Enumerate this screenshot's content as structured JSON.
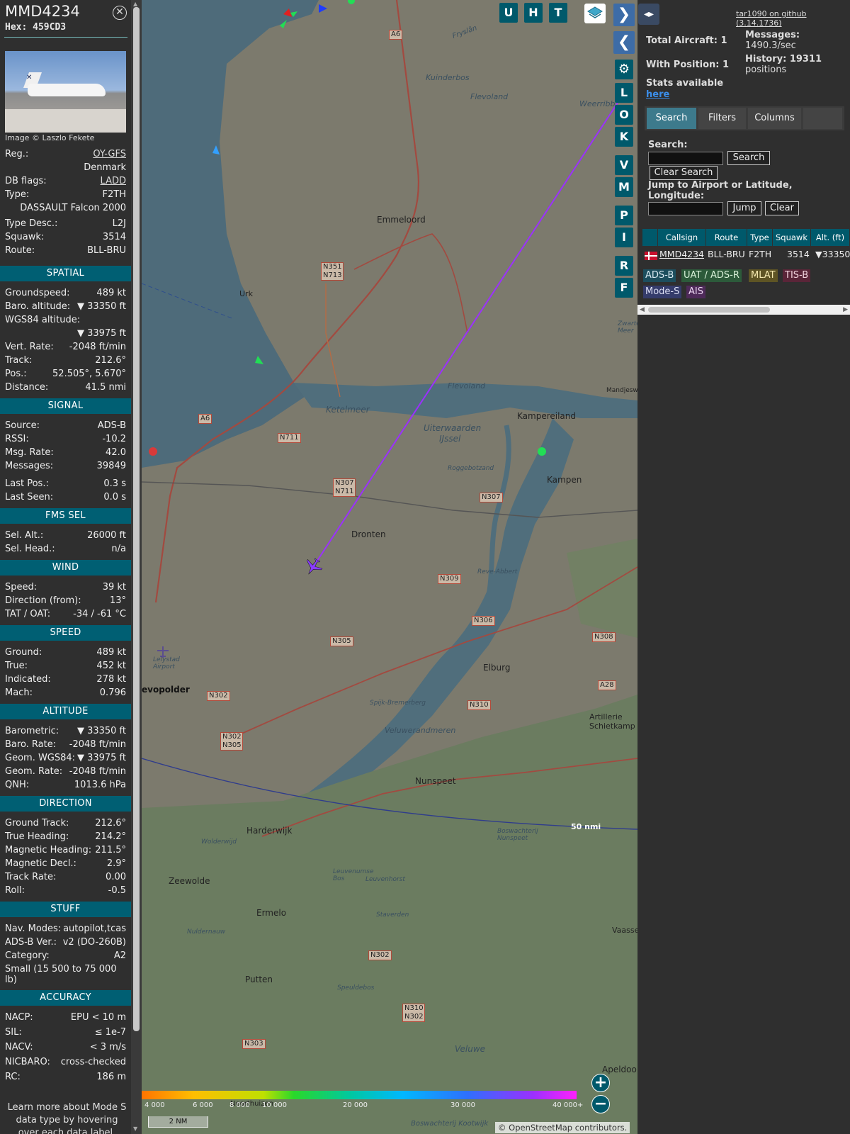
{
  "selected": {
    "callsign": "MMD4234",
    "hex_label": "Hex: 459CD3",
    "image_credit": "Image © Laszlo Fekete",
    "reg_label": "Reg.:",
    "reg": "OY-GFS",
    "country": "Denmark",
    "dbflags_label": "DB flags:",
    "dbflags": "LADD",
    "type_label": "Type:",
    "type": "F2TH",
    "type_full": "DASSAULT Falcon 2000",
    "typedesc_label": "Type Desc.:",
    "typedesc": "L2J",
    "squawk_label": "Squawk:",
    "squawk": "3514",
    "route_label": "Route:",
    "route": "BLL-BRU"
  },
  "sections": {
    "spatial": {
      "title": "SPATIAL",
      "rows": [
        {
          "k": "Groundspeed:",
          "v": "489 kt"
        },
        {
          "k": "Baro. altitude:",
          "v": "▼ 33350 ft"
        },
        {
          "k": "WGS84 altitude:",
          "v": ""
        },
        {
          "k": "",
          "v": "▼ 33975 ft"
        },
        {
          "k": "Vert. Rate:",
          "v": "-2048 ft/min"
        },
        {
          "k": "Track:",
          "v": "212.6°"
        },
        {
          "k": "Pos.:",
          "v": "52.505°, 5.670°"
        },
        {
          "k": "Distance:",
          "v": "41.5 nmi"
        }
      ]
    },
    "signal": {
      "title": "SIGNAL",
      "rows": [
        {
          "k": "Source:",
          "v": "ADS-B"
        },
        {
          "k": "RSSI:",
          "v": "-10.2"
        },
        {
          "k": "Msg. Rate:",
          "v": "42.0"
        },
        {
          "k": "Messages:",
          "v": "39849"
        },
        {
          "k": "Last Pos.:",
          "v": "0.3 s"
        },
        {
          "k": "Last Seen:",
          "v": "0.0 s"
        }
      ]
    },
    "fms": {
      "title": "FMS SEL",
      "rows": [
        {
          "k": "Sel. Alt.:",
          "v": "26000 ft"
        },
        {
          "k": "Sel. Head.:",
          "v": "n/a"
        }
      ]
    },
    "wind": {
      "title": "WIND",
      "rows": [
        {
          "k": "Speed:",
          "v": "39 kt"
        },
        {
          "k": "Direction (from):",
          "v": "13°"
        },
        {
          "k": "TAT / OAT:",
          "v": "-34 / -61 °C"
        }
      ]
    },
    "speed": {
      "title": "SPEED",
      "rows": [
        {
          "k": "Ground:",
          "v": "489 kt"
        },
        {
          "k": "True:",
          "v": "452 kt"
        },
        {
          "k": "Indicated:",
          "v": "278 kt"
        },
        {
          "k": "Mach:",
          "v": "0.796"
        }
      ]
    },
    "altitude": {
      "title": "ALTITUDE",
      "rows": [
        {
          "k": "Barometric:",
          "v": "▼ 33350 ft"
        },
        {
          "k": "Baro. Rate:",
          "v": "-2048 ft/min"
        },
        {
          "k": "Geom. WGS84:",
          "v": "▼ 33975 ft"
        },
        {
          "k": "Geom. Rate:",
          "v": "-2048 ft/min"
        },
        {
          "k": "QNH:",
          "v": "1013.6 hPa"
        }
      ]
    },
    "direction": {
      "title": "DIRECTION",
      "rows": [
        {
          "k": "Ground Track:",
          "v": "212.6°"
        },
        {
          "k": "True Heading:",
          "v": "214.2°"
        },
        {
          "k": "Magnetic Heading:",
          "v": "211.5°"
        },
        {
          "k": "Magnetic Decl.:",
          "v": "2.9°"
        },
        {
          "k": "Track Rate:",
          "v": "0.00"
        },
        {
          "k": "Roll:",
          "v": "-0.5"
        }
      ]
    },
    "stuff": {
      "title": "STUFF",
      "rows": [
        {
          "k": "Nav. Modes:",
          "v": "autopilot,tcas"
        },
        {
          "k": "ADS-B Ver.:",
          "v": "v2 (DO-260B)"
        },
        {
          "k": "Category:",
          "v": "A2"
        }
      ],
      "category_desc": "Small (15 500 to 75 000 lb)"
    },
    "accuracy": {
      "title": "ACCURACY",
      "rows": [
        {
          "k": "NACP:",
          "v": "EPU < 10 m"
        },
        {
          "k": "SIL:",
          "v": "≤ 1e-7"
        },
        {
          "k": "NACV:",
          "v": "< 3 m/s"
        },
        {
          "k": "NICBARO:",
          "v": "cross-checked"
        },
        {
          "k": "RC:",
          "v": "186 m"
        }
      ]
    }
  },
  "learn_more": "Learn more about Mode S data type by hovering over each data label.",
  "map": {
    "buttons_top": [
      "U",
      "H",
      "T"
    ],
    "buttons_side": [
      "L",
      "O",
      "K",
      "V",
      "M",
      "P",
      "I",
      "R",
      "F"
    ],
    "labels": {
      "emmeloord": "Emmeloord",
      "urk": "Urk",
      "dronten": "Dronten",
      "kampen": "Kampen",
      "kampereiland": "Kampereiland",
      "elburg": "Elburg",
      "nunspeet": "Nunspeet",
      "harderwijk": "Harderwijk",
      "zeewolde": "Zeewolde",
      "ermelo": "Ermelo",
      "putten": "Putten",
      "ketelmeer": "Ketelmeer",
      "uiterwaarden": "Uiterwaarden",
      "ijssel": "IJssel",
      "flevoland1": "Flevoland",
      "flevoland2": "Flevoland",
      "veluwerandmeren": "Veluwerandmeren",
      "veluwe": "Veluwe",
      "kuinderbos": "Kuinderbos",
      "lelystad": "Lelystad Airport",
      "evopolder": "evopolder",
      "artillerie": "Artillerie Schietkamp",
      "apeldoo": "Apeldoo",
      "vaasse": "Vaasse",
      "roggebotzand": "Roggebotzand",
      "revebbert": "Reve-Abbert",
      "spijk": "Spijk-Bremerberg",
      "leuvenhorst": "Leuvenhorst",
      "staverden": "Staverden",
      "speuldebos": "Speuldebos",
      "weerribben": "Weerribb",
      "zwarte": "Zwarte Meer",
      "mandjes": "Mandjesw",
      "fryslan": "Fryslân",
      "boswachterij": "Boswachterij Nunspeet",
      "leuvenumse": "Leuvenumse Bos",
      "noorthuizen": "Noorthuizen",
      "wolderwijd": "Wolderwijd",
      "nuldernauw": "Nuldernauw",
      "boskootwijk": "Boswachterij Kootwijk"
    },
    "shields": [
      "A6",
      "A6",
      "N351 N713",
      "N711",
      "N307 N711",
      "N307",
      "N309",
      "N306",
      "N305",
      "N302",
      "N302 N305",
      "N308",
      "A28",
      "N310",
      "N302",
      "N310 N302",
      "N303"
    ],
    "nm_label": "50 nmi",
    "colorbar_ticks": [
      "4 000",
      "6 000",
      "8 000",
      "10 000",
      "20 000",
      "30 000",
      "40 000+"
    ],
    "scale": "2 NM",
    "attribution": "© OpenStreetMap contributors."
  },
  "header": {
    "github": "tar1090 on github (3.14.1736)",
    "total_aircraft": "Total Aircraft: 1",
    "with_position": "With Position: 1",
    "messages": "Messages:",
    "messages_rate": "1490.3/sec",
    "history": "History: 19311",
    "history_unit": "positions",
    "stats": "Stats available",
    "here": "here"
  },
  "tabs": [
    "Search",
    "Filters",
    "Columns"
  ],
  "search": {
    "label": "Search:",
    "button": "Search",
    "clear": "Clear Search",
    "jump_label": "Jump to Airport or Latitude, Longitude:",
    "jump": "Jump",
    "clear2": "Clear"
  },
  "table": {
    "headers": [
      "",
      "Callsign",
      "Route",
      "Type",
      "Squawk",
      "Alt. (ft)"
    ],
    "rows": [
      {
        "callsign": "MMD4234",
        "route": "BLL-BRU",
        "type": "F2TH",
        "squawk": "3514",
        "alt": "▼33350"
      }
    ]
  },
  "sources": [
    {
      "label": "ADS-B",
      "bg": "#1d4e5e",
      "fg": "#d8e8f0"
    },
    {
      "label": "UAT / ADS-R",
      "bg": "#2c5a3a",
      "fg": "#d8f0d8"
    },
    {
      "label": "MLAT",
      "bg": "#5e5424",
      "fg": "#f5e9b0"
    },
    {
      "label": "TIS-B",
      "bg": "#5a2538",
      "fg": "#f3d4de"
    },
    {
      "label": "Mode-S",
      "bg": "#353c6b",
      "fg": "#dcdff5"
    },
    {
      "label": "AIS",
      "bg": "#4e2a59",
      "fg": "#ecd7f2"
    }
  ],
  "colors": {
    "section": "#005f73",
    "track": "#9b30ff",
    "plane": "#8a3cff"
  }
}
